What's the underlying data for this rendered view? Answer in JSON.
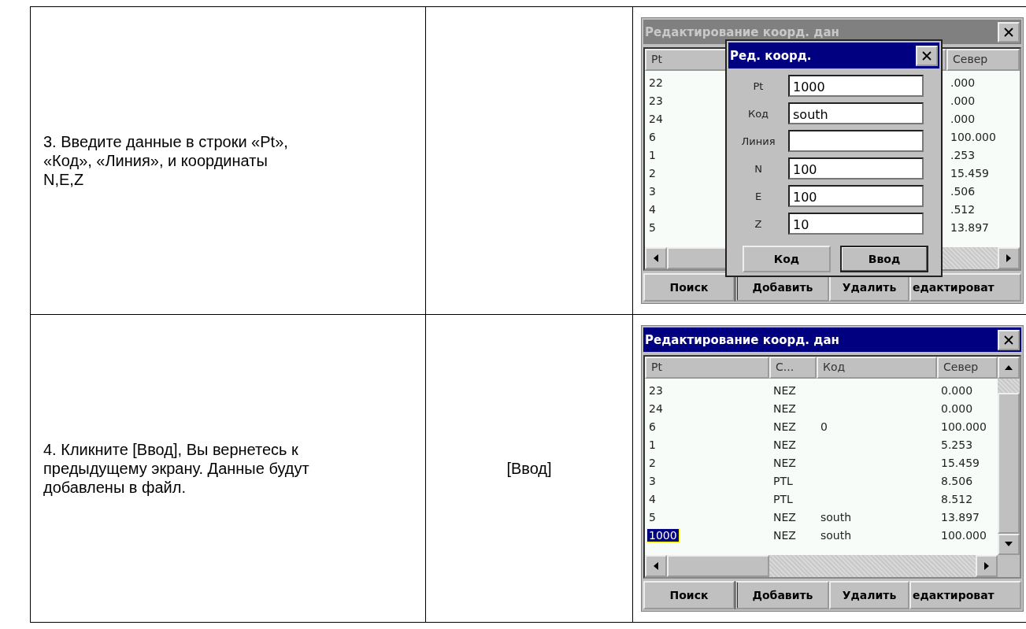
{
  "steps": [
    {
      "instruction": "3. Введите данные в строки «Pt»,\n«Код», «Линия», и координаты\nN,E,Z",
      "screen": {
        "title": "Редактирование коорд. дан",
        "active": false,
        "columns": [
          "Pt",
          "Север"
        ],
        "rows": [
          {
            "cells": [
              "22",
              ".000"
            ],
            "selected": false
          },
          {
            "cells": [
              "23",
              ".000"
            ],
            "selected": false
          },
          {
            "cells": [
              "24",
              ".000"
            ],
            "selected": false
          },
          {
            "cells": [
              "6",
              "100.000"
            ],
            "selected": false
          },
          {
            "cells": [
              "1",
              ".253"
            ],
            "selected": false
          },
          {
            "cells": [
              "2",
              "15.459"
            ],
            "selected": false
          },
          {
            "cells": [
              "3",
              ".506"
            ],
            "selected": false
          },
          {
            "cells": [
              "4",
              ".512"
            ],
            "selected": false
          },
          {
            "cells": [
              "5",
              "13.897"
            ],
            "selected": false
          }
        ],
        "buttons": [
          "Поиск",
          "Добавить",
          "Удалить",
          "едактироват"
        ],
        "dialog": {
          "title": "Ред. коорд.",
          "fields": [
            {
              "label": "Pt",
              "value": "1000"
            },
            {
              "label": "Код",
              "value": "south"
            },
            {
              "label": "Линия"
            },
            {
              "label": "N",
              "value": "100"
            },
            {
              "label": "E",
              "value": "100"
            },
            {
              "label": "Z",
              "value": "10"
            }
          ],
          "buttons": [
            "Код",
            "Ввод"
          ]
        }
      }
    },
    {
      "instruction": "4. Кликните [Ввод], Вы вернетесь к\nпредыдущему экрану. Данные будут\nдобавлены в файл.",
      "action": "[Ввод]",
      "screen": {
        "title": "Редактирование коорд. дан",
        "active": true,
        "columns": [
          "Pt",
          "С...",
          "Код",
          "Север"
        ],
        "rows": [
          {
            "cells": [
              "23",
              "NEZ",
              "",
              "0.000"
            ],
            "selected": false
          },
          {
            "cells": [
              "24",
              "NEZ",
              "",
              "0.000"
            ],
            "selected": false
          },
          {
            "cells": [
              "6",
              "NEZ",
              "0",
              "100.000"
            ],
            "selected": false
          },
          {
            "cells": [
              "1",
              "NEZ",
              "",
              "5.253"
            ],
            "selected": false
          },
          {
            "cells": [
              "2",
              "NEZ",
              "",
              "15.459"
            ],
            "selected": false
          },
          {
            "cells": [
              "3",
              "PTL",
              "",
              "8.506"
            ],
            "selected": false
          },
          {
            "cells": [
              "4",
              "PTL",
              "",
              "8.512"
            ],
            "selected": false
          },
          {
            "cells": [
              "5",
              "NEZ",
              "south",
              "13.897"
            ],
            "selected": false
          },
          {
            "cells": [
              "1000",
              "NEZ",
              "south",
              "100.000"
            ],
            "selected": true
          }
        ],
        "buttons": [
          "Поиск",
          "Добавить",
          "Удалить",
          "едактироват"
        ]
      }
    }
  ]
}
